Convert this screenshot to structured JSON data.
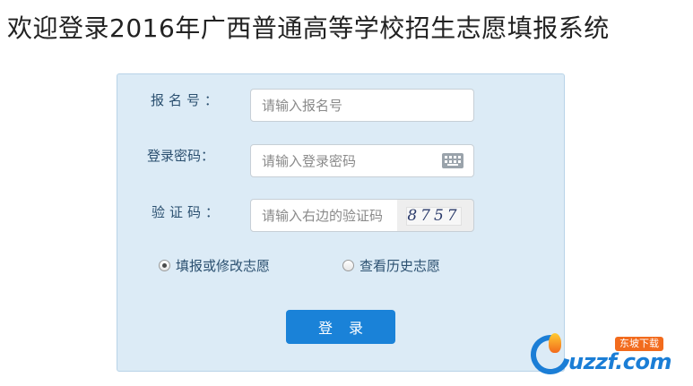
{
  "page": {
    "title": "欢迎登录2016年广西普通高等学校招生志愿填报系统"
  },
  "form": {
    "registration": {
      "label": "报名号：",
      "placeholder": "请输入报名号",
      "value": ""
    },
    "password": {
      "label": "登录密码：",
      "placeholder": "请输入登录密码",
      "value": "",
      "keyboard_icon": "keyboard-icon"
    },
    "captcha": {
      "label": "验证码：",
      "placeholder": "请输入右边的验证码",
      "value": "",
      "image_text": "8757"
    },
    "modes": [
      {
        "label": "填报或修改志愿",
        "selected": true
      },
      {
        "label": "查看历史志愿",
        "selected": false
      }
    ],
    "submit_label": "登录"
  },
  "watermark": {
    "tag": "东坡下载",
    "domain": "uzzf.com"
  },
  "colors": {
    "panel_bg": "#dcebf6",
    "panel_border": "#b8d3e8",
    "label_text": "#2b5070",
    "button_bg": "#1a82d8",
    "watermark_blue": "#1b7ed6",
    "watermark_orange": "#f26b1d"
  }
}
